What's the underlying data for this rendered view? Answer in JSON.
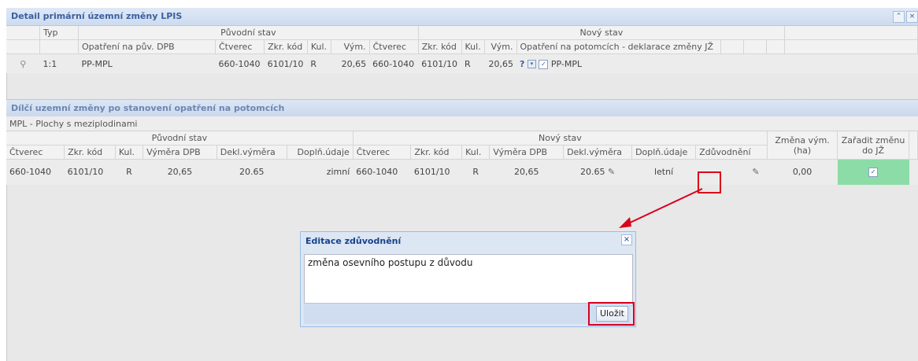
{
  "panel": {
    "title": "Detail primární územní změny LPIS",
    "collapse_icon": "double-chevron-up-icon",
    "close_icon": "close-icon"
  },
  "top_table": {
    "group_headers": {
      "typ": "Typ",
      "original": "Původní stav",
      "new": "Nový stav"
    },
    "col_headers": {
      "measure_orig": "Opatření na pův. DPB",
      "ctverec": "Čtverec",
      "zkr_kod": "Zkr. kód",
      "kul": "Kul.",
      "vym": "Vým.",
      "ctverec2": "Čtverec",
      "zkr_kod2": "Zkr. kód",
      "kul2": "Kul.",
      "vym2": "Vým.",
      "measure_new": "Opatření na potomcích - deklarace změny JŽ"
    },
    "row": {
      "typ": "1:1",
      "measure": "PP-MPL",
      "ctverec": "660-1040",
      "zkr_kod": "6101/10",
      "kul": "R",
      "vym": "20,65",
      "ctverec2": "660-1040",
      "zkr_kod2": "6101/10",
      "kul2": "R",
      "vym2": "20,65",
      "q": "?",
      "measure_new": "PP-MPL",
      "checked": "✓"
    }
  },
  "sub_panel": {
    "title": "Dílčí uzemní změny po stanovení opatření na potomcích",
    "group": "MPL - Plochy s meziplodinami"
  },
  "bottom_table": {
    "group_headers": {
      "original": "Původní stav",
      "new": "Nový stav",
      "zmena": "Změna vým. (ha)",
      "zaradit": "Zařadit změnu do JŽ"
    },
    "col_headers": {
      "ctverec": "Čtverec",
      "zkr_kod": "Zkr. kód",
      "kul": "Kul.",
      "vymera": "Výměra DPB",
      "dekl": "Dekl.výměra",
      "dopln": "Doplň.údaje",
      "ctverec2": "Čtverec",
      "zkr_kod2": "Zkr. kód",
      "kul2": "Kul.",
      "vymera2": "Výměra DPB",
      "dekl2": "Dekl.výměra",
      "dopln2": "Doplň.údaje",
      "zduvod": "Zdůvodnění"
    },
    "row": {
      "ctverec": "660-1040",
      "zkr_kod": "6101/10",
      "kul": "R",
      "vymera": "20,65",
      "dekl": "20.65",
      "dopln": "zimní",
      "ctverec2": "660-1040",
      "zkr_kod2": "6101/10",
      "kul2": "R",
      "vymera2": "20,65",
      "dekl2": "20.65",
      "dopln2": "letní",
      "zmena": "0,00",
      "checked": "✓"
    }
  },
  "dialog": {
    "title": "Editace zdůvodnění",
    "text": "změna osevního postupu z důvodu",
    "save_label": "Uložit"
  },
  "colors": {
    "highlight_red": "#d9001b",
    "checkbox_green": "#8cdca8",
    "title_blue": "#3b5f9e"
  }
}
